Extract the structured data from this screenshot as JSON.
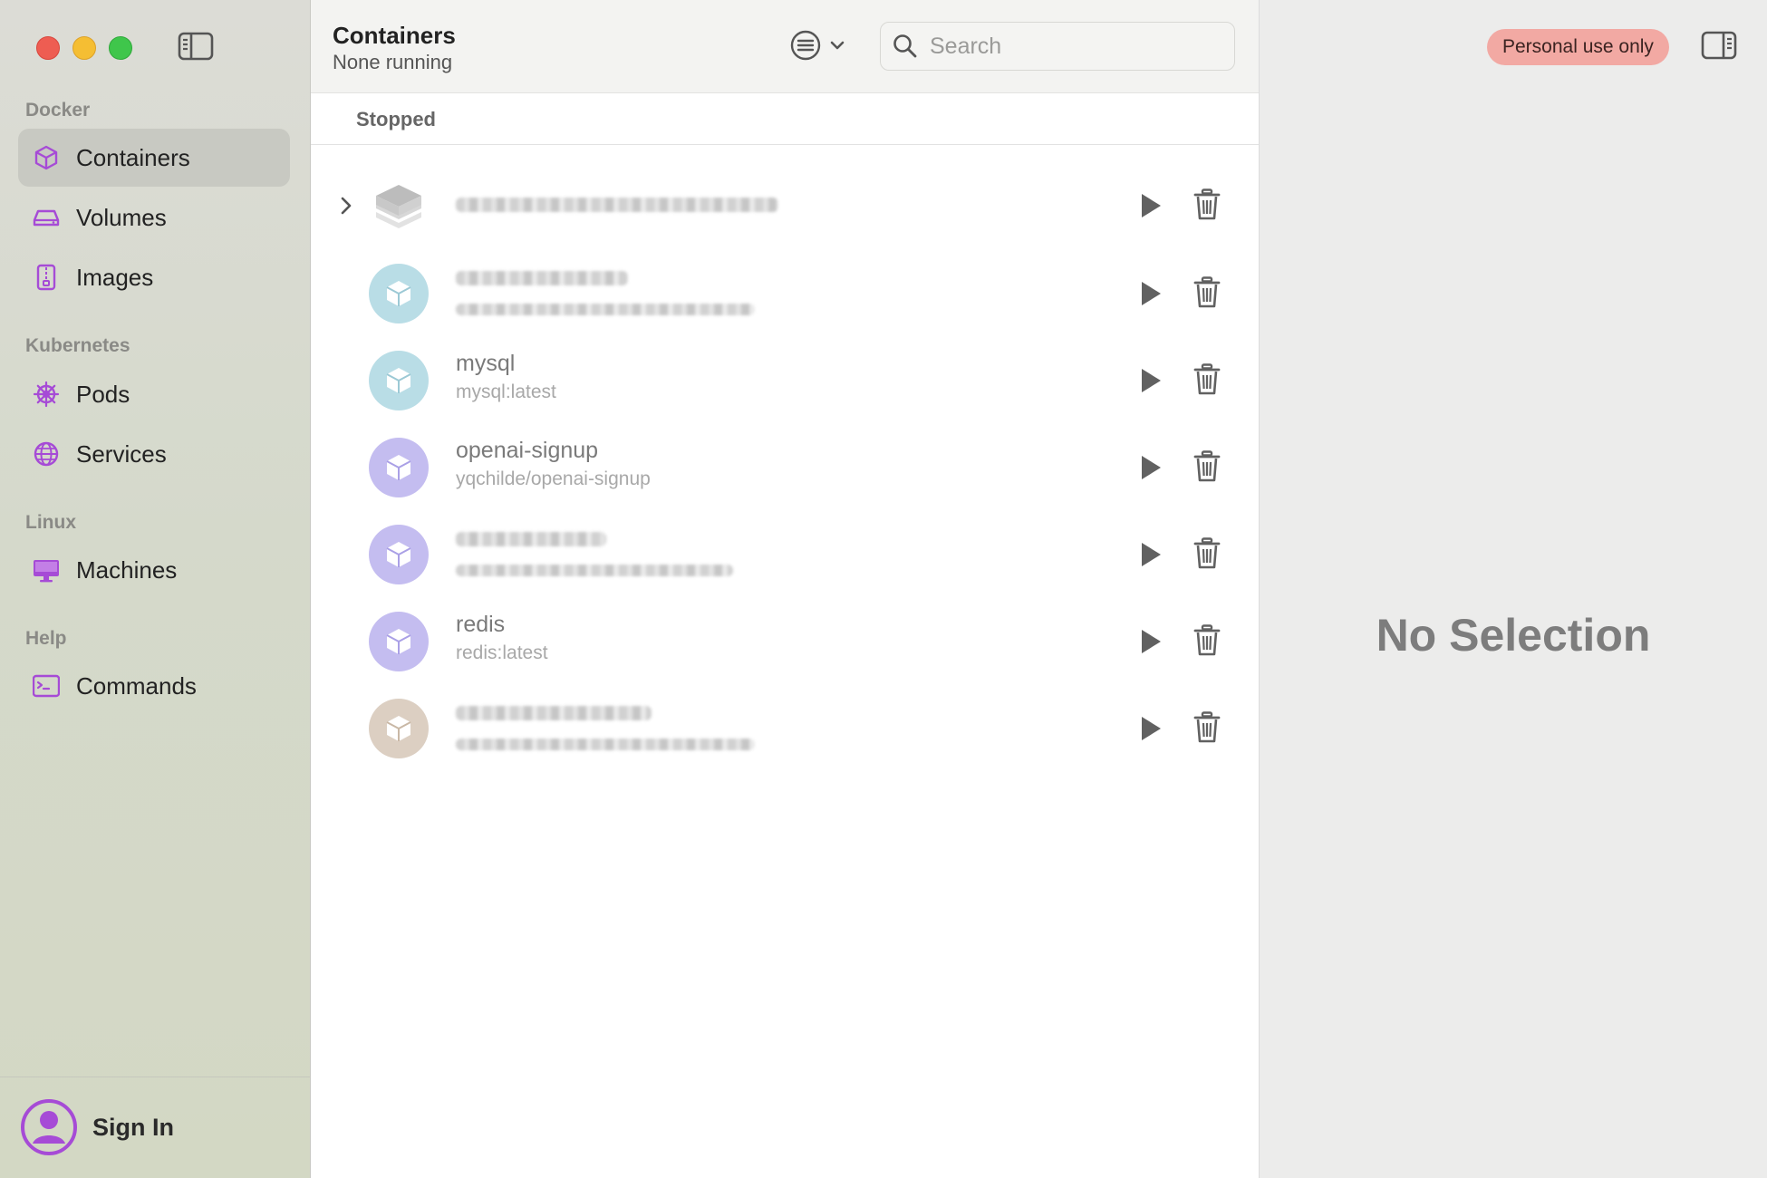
{
  "sidebar": {
    "sections": [
      {
        "label": "Docker"
      },
      {
        "label": "Kubernetes"
      },
      {
        "label": "Linux"
      },
      {
        "label": "Help"
      }
    ],
    "items": [
      {
        "label": "Containers",
        "icon": "cube-icon",
        "active": true
      },
      {
        "label": "Volumes",
        "icon": "drive-icon"
      },
      {
        "label": "Images",
        "icon": "archive-icon"
      },
      {
        "label": "Pods",
        "icon": "helm-wheel-icon"
      },
      {
        "label": "Services",
        "icon": "globe-icon"
      },
      {
        "label": "Machines",
        "icon": "desktop-icon"
      },
      {
        "label": "Commands",
        "icon": "terminal-icon"
      }
    ],
    "sign_in_label": "Sign In"
  },
  "toolbar": {
    "title": "Containers",
    "subtitle": "None running",
    "search_placeholder": "Search"
  },
  "group": {
    "label": "Stopped"
  },
  "containers": [
    {
      "name": "",
      "image": "",
      "kind": "compose-stack",
      "obscured": true
    },
    {
      "name": "",
      "image": "",
      "color": "#b9dde6",
      "obscured": true
    },
    {
      "name": "mysql",
      "image": "mysql:latest",
      "color": "#b9dde6"
    },
    {
      "name": "openai-signup",
      "image": "yqchilde/openai-signup",
      "color": "#c4bdf0"
    },
    {
      "name": "",
      "image": "",
      "color": "#c4bdf0",
      "obscured": true
    },
    {
      "name": "redis",
      "image": "redis:latest",
      "color": "#c4bdf0"
    },
    {
      "name": "",
      "image": "",
      "color": "#dccfc2",
      "obscured": true
    }
  ],
  "detail": {
    "license_badge": "Personal use only",
    "empty_state": "No Selection"
  },
  "colors": {
    "accent_purple": "#a64bd6",
    "license_badge_bg": "#f2a9a3"
  }
}
